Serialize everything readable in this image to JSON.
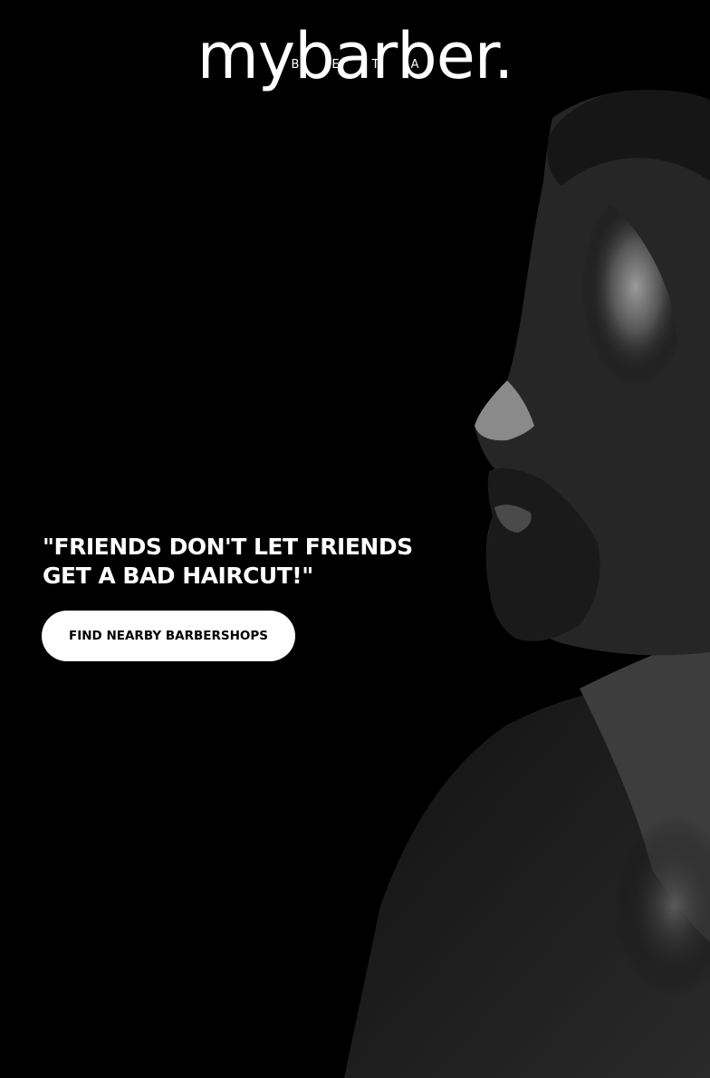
{
  "brand": {
    "wordmark": "mybarber.",
    "beta": "BETA"
  },
  "hero": {
    "tagline_line1": "\"FRIENDS DON'T LET FRIENDS",
    "tagline_line2": "GET A BAD HAIRCUT!\"",
    "cta_label": "FIND NEARBY BARBERSHOPS"
  },
  "colors": {
    "background": "#000000",
    "text": "#ffffff",
    "button_bg": "#ffffff",
    "button_text": "#000000"
  }
}
